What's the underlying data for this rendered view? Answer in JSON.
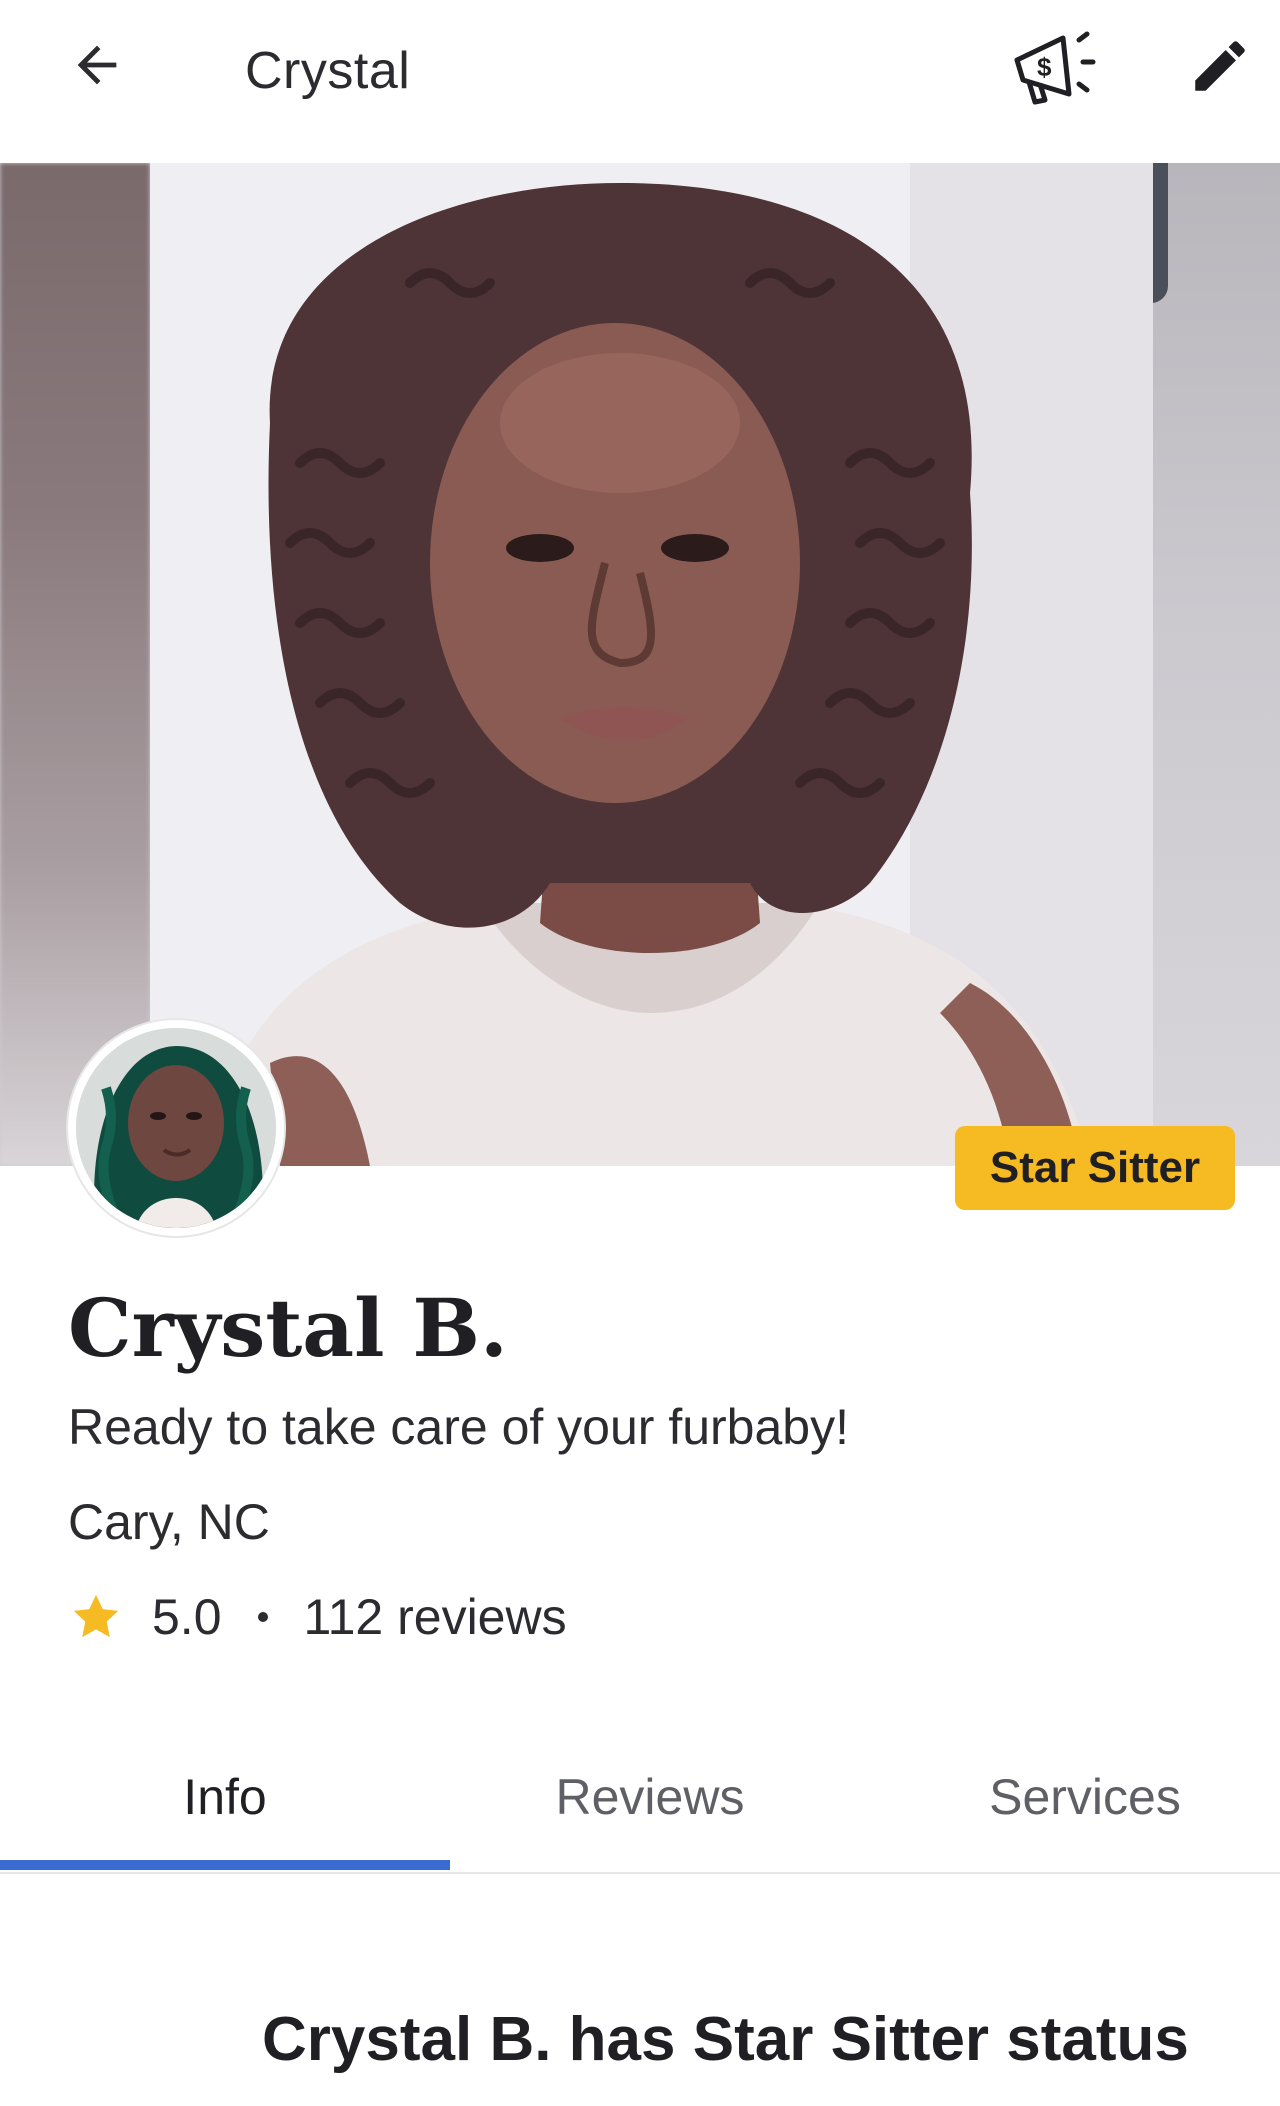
{
  "header": {
    "title": "Crystal",
    "back_icon": "arrow-left-icon",
    "promo_icon": "megaphone-dollar-icon",
    "edit_icon": "pencil-icon"
  },
  "gallery": {
    "badge_label": "Star Sitter"
  },
  "profile": {
    "name": "Crystal B.",
    "tagline": "Ready to take care of your furbaby!",
    "location": "Cary, NC",
    "rating": "5.0",
    "reviews_label": "112 reviews",
    "star_icon": "star-icon"
  },
  "tabs": [
    {
      "label": "Info",
      "active": true
    },
    {
      "label": "Reviews",
      "active": false
    },
    {
      "label": "Services",
      "active": false
    }
  ],
  "section": {
    "heading": "Crystal B. has Star Sitter status"
  },
  "colors": {
    "badge": "#f6bb22",
    "star": "#f6bb22",
    "tab_indicator": "#3a6bd1",
    "text": "#1f1f24"
  }
}
